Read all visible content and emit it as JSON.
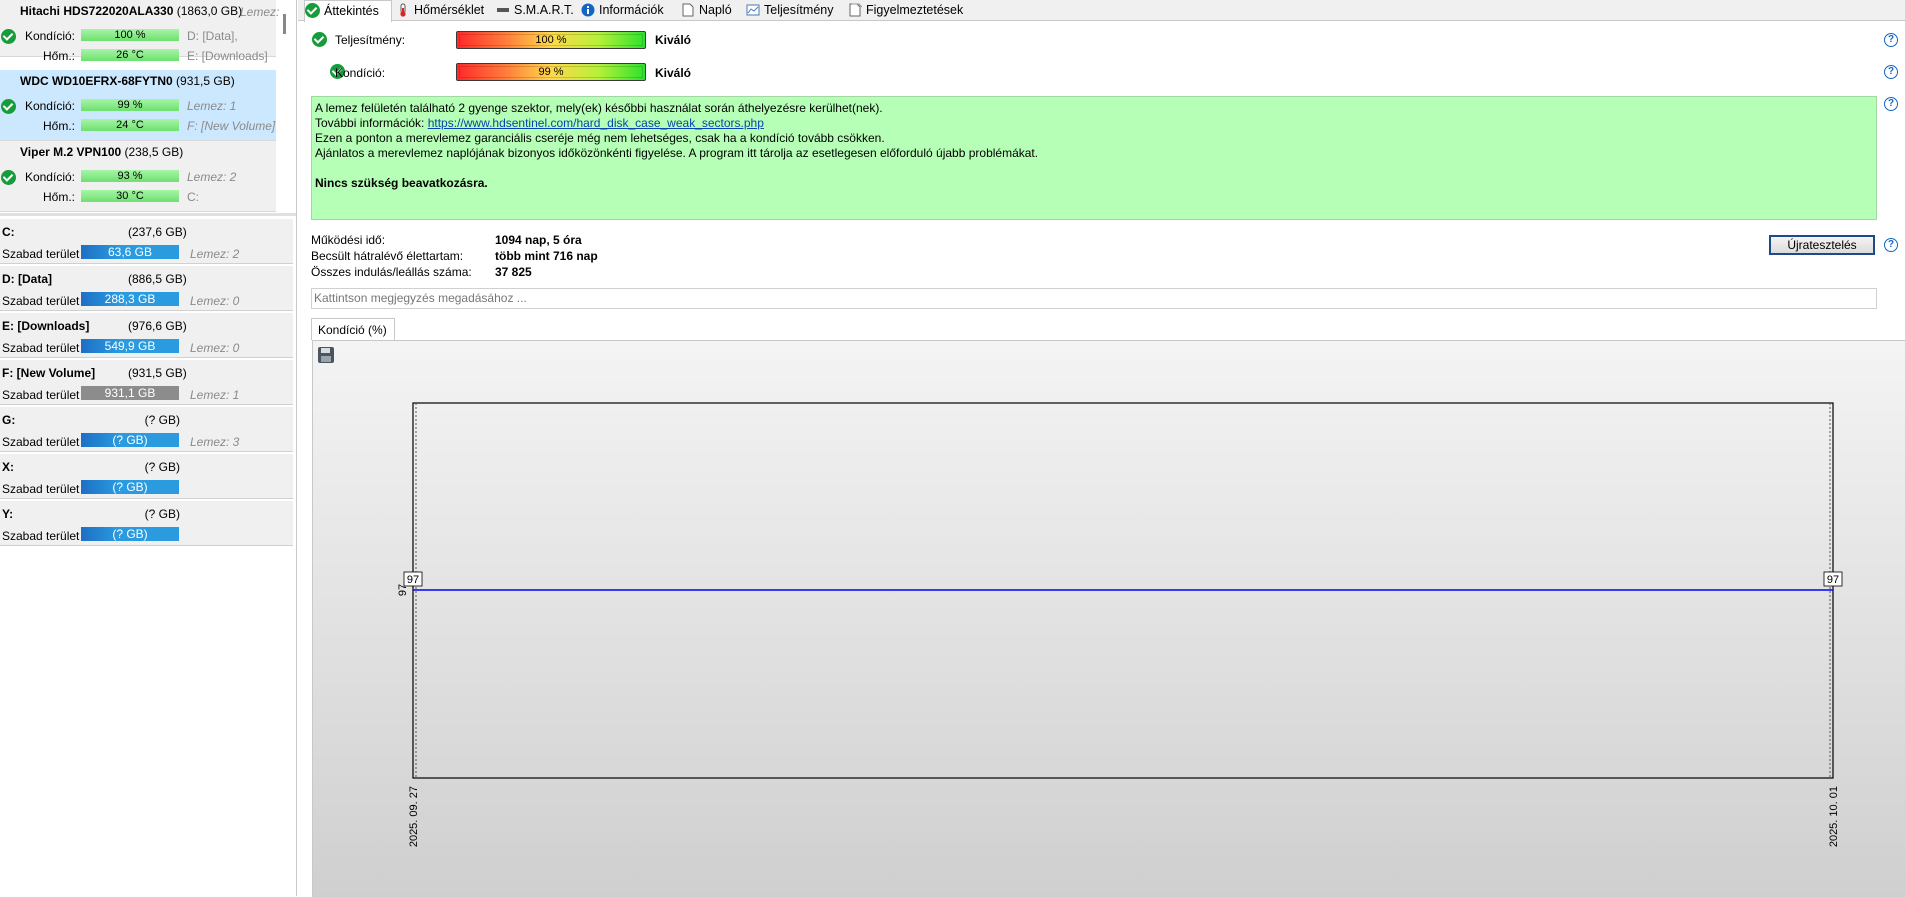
{
  "disks": [
    {
      "name": "Hitachi HDS722020ALA330",
      "size": "(1863,0 GB)",
      "side_top": "Lemez:",
      "health_label": "Kondíció:",
      "health": "100 %",
      "temp_label": "Hőm.:",
      "temp": "26 °C",
      "vol1": "D: [Data],",
      "vol2": "E: [Downloads]",
      "selected": false
    },
    {
      "name": "WDC WD10EFRX-68FYTN0",
      "size": "(931,5 GB)",
      "health_label": "Kondíció:",
      "health": "99 %",
      "temp_label": "Hőm.:",
      "temp": "24 °C",
      "vol1": "Lemez: 1",
      "vol2": "F: [New Volume]",
      "selected": true
    },
    {
      "name": "Viper M.2 VPN100",
      "size": "(238,5 GB)",
      "health_label": "Kondíció:",
      "health": "93 %",
      "temp_label": "Hőm.:",
      "temp": "30 °C",
      "vol1": "Lemez: 2",
      "vol2": "C:",
      "selected": false
    }
  ],
  "volumes": [
    {
      "name": "C:",
      "size": "(237,6 GB)",
      "free_label": "Szabad terület",
      "free": "63,6 GB",
      "disk": "Lemez: 2",
      "bar": "blue",
      "fill": 0.27
    },
    {
      "name": "D: [Data]",
      "size": "(886,5 GB)",
      "free_label": "Szabad terület",
      "free": "288,3 GB",
      "disk": "Lemez: 0",
      "bar": "blue",
      "fill": 0.33
    },
    {
      "name": "E: [Downloads]",
      "size": "(976,6 GB)",
      "free_label": "Szabad terület",
      "free": "549,9 GB",
      "disk": "Lemez: 0",
      "bar": "blue",
      "fill": 0.56
    },
    {
      "name": "F: [New Volume]",
      "size": "(931,5 GB)",
      "free_label": "Szabad terület",
      "free": "931,1 GB",
      "disk": "Lemez: 1",
      "bar": "grey",
      "fill": 1.0
    },
    {
      "name": "G:",
      "size": "(? GB)",
      "free_label": "Szabad terület",
      "free": "(? GB)",
      "disk": "Lemez: 3",
      "bar": "blue",
      "fill": 1.0
    },
    {
      "name": "X:",
      "size": "(? GB)",
      "free_label": "Szabad terület",
      "free": "(? GB)",
      "disk": "",
      "bar": "blue",
      "fill": 1.0
    },
    {
      "name": "Y:",
      "size": "(? GB)",
      "free_label": "Szabad terület",
      "free": "(? GB)",
      "disk": "",
      "bar": "blue",
      "fill": 1.0
    }
  ],
  "tabs": [
    {
      "label": "Áttekintés",
      "icon": "check-icon",
      "active": true
    },
    {
      "label": "Hőmérséklet",
      "icon": "thermometer-icon",
      "active": false
    },
    {
      "label": "S.M.A.R.T.",
      "icon": "smart-icon",
      "active": false
    },
    {
      "label": "Információk",
      "icon": "info-icon",
      "active": false
    },
    {
      "label": "Napló",
      "icon": "log-icon",
      "active": false
    },
    {
      "label": "Teljesítmény",
      "icon": "performance-icon",
      "active": false
    },
    {
      "label": "Figyelmeztetések",
      "icon": "alerts-icon",
      "active": false
    }
  ],
  "overview": {
    "performance_label": "Teljesítmény:",
    "performance_value": "100 %",
    "performance_text": "Kiváló",
    "performance_level": 1.0,
    "health_label": "Kondíció:",
    "health_value": "99 %",
    "health_text": "Kiváló",
    "health_level": 0.99
  },
  "message": {
    "line1": "A lemez felületén található 2 gyenge szektor, mely(ek) későbbi használat során áthelyezésre kerülhet(nek).",
    "line2_prefix": "További információk: ",
    "line2_link": "https://www.hdsentinel.com/hard_disk_case_weak_sectors.php",
    "line3": "Ezen a ponton a merevlemez garanciális cseréje még nem lehetséges, csak ha a kondíció tovább csökken.",
    "line4": "Ajánlatos a merevlemez naplójának bizonyos időközönkénti figyelése. A program itt tárolja az esetlegesen előforduló újabb problémákat.",
    "line5": "Nincs szükség beavatkozásra."
  },
  "stats": [
    {
      "label": "Működési idő:",
      "value": "1094 nap, 5 óra"
    },
    {
      "label": "Becsült hátralévő élettartam:",
      "value": "több mint 716 nap"
    },
    {
      "label": "Összes indulás/leállás száma:",
      "value": "37 825"
    }
  ],
  "retest_label": "Újratesztelés",
  "note_placeholder": "Kattintson megjegyzés megadásához ...",
  "chart_tab_label": "Kondíció  (%)",
  "chart_data": {
    "type": "line",
    "x": [
      "2025. 09. 27",
      "2025. 10. 01"
    ],
    "series": [
      {
        "values": [
          97,
          97
        ],
        "color": "#0000ff"
      }
    ],
    "point_labels": [
      "97",
      "97"
    ],
    "ytick": "97",
    "xlabel": "",
    "ylabel": "",
    "ylim": [
      96,
      98
    ]
  }
}
